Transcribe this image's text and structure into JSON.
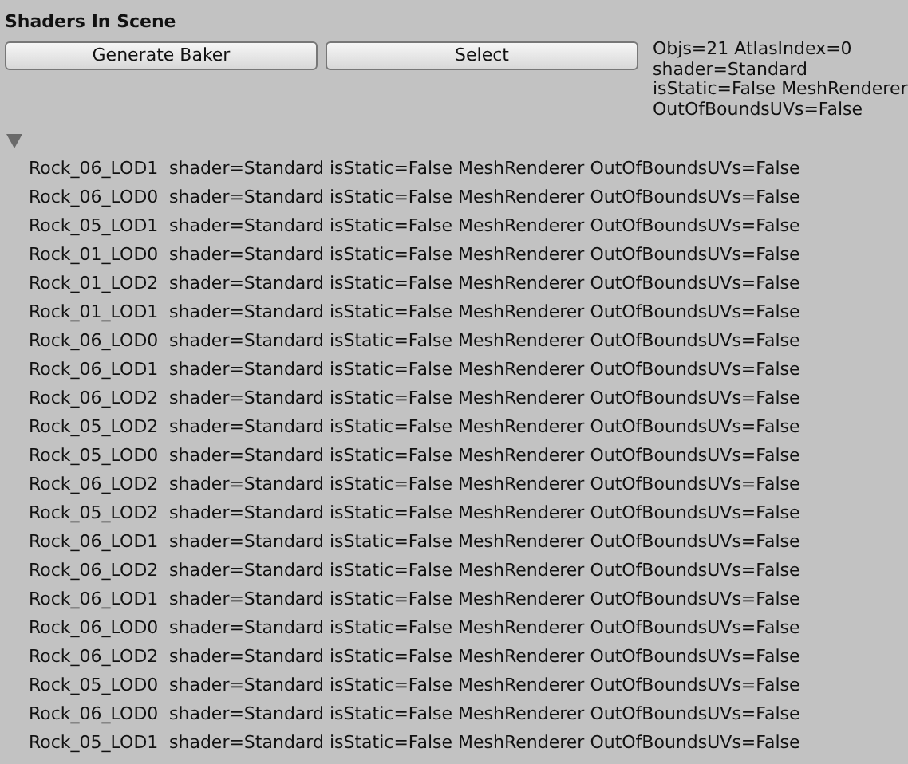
{
  "title": "Shaders In Scene",
  "buttons": [
    {
      "label": "Generate Baker"
    },
    {
      "label": "Select"
    }
  ],
  "info_lines": [
    "Objs=21 AtlasIndex=0",
    "shader=Standard",
    "isStatic=False MeshRenderer",
    "OutOfBoundsUVs=False"
  ],
  "foldout": {
    "expanded": true
  },
  "rows": [
    {
      "name": "Rock_06_LOD1",
      "details": "shader=Standard isStatic=False MeshRenderer OutOfBoundsUVs=False"
    },
    {
      "name": "Rock_06_LOD0",
      "details": "shader=Standard isStatic=False MeshRenderer OutOfBoundsUVs=False"
    },
    {
      "name": "Rock_05_LOD1",
      "details": "shader=Standard isStatic=False MeshRenderer OutOfBoundsUVs=False"
    },
    {
      "name": "Rock_01_LOD0",
      "details": "shader=Standard isStatic=False MeshRenderer OutOfBoundsUVs=False"
    },
    {
      "name": "Rock_01_LOD2",
      "details": "shader=Standard isStatic=False MeshRenderer OutOfBoundsUVs=False"
    },
    {
      "name": "Rock_01_LOD1",
      "details": "shader=Standard isStatic=False MeshRenderer OutOfBoundsUVs=False"
    },
    {
      "name": "Rock_06_LOD0",
      "details": "shader=Standard isStatic=False MeshRenderer OutOfBoundsUVs=False"
    },
    {
      "name": "Rock_06_LOD1",
      "details": "shader=Standard isStatic=False MeshRenderer OutOfBoundsUVs=False"
    },
    {
      "name": "Rock_06_LOD2",
      "details": "shader=Standard isStatic=False MeshRenderer OutOfBoundsUVs=False"
    },
    {
      "name": "Rock_05_LOD2",
      "details": "shader=Standard isStatic=False MeshRenderer OutOfBoundsUVs=False"
    },
    {
      "name": "Rock_05_LOD0",
      "details": "shader=Standard isStatic=False MeshRenderer OutOfBoundsUVs=False"
    },
    {
      "name": "Rock_06_LOD2",
      "details": "shader=Standard isStatic=False MeshRenderer OutOfBoundsUVs=False"
    },
    {
      "name": "Rock_05_LOD2",
      "details": "shader=Standard isStatic=False MeshRenderer OutOfBoundsUVs=False"
    },
    {
      "name": "Rock_06_LOD1",
      "details": "shader=Standard isStatic=False MeshRenderer OutOfBoundsUVs=False"
    },
    {
      "name": "Rock_06_LOD2",
      "details": "shader=Standard isStatic=False MeshRenderer OutOfBoundsUVs=False"
    },
    {
      "name": "Rock_06_LOD1",
      "details": "shader=Standard isStatic=False MeshRenderer OutOfBoundsUVs=False"
    },
    {
      "name": "Rock_06_LOD0",
      "details": "shader=Standard isStatic=False MeshRenderer OutOfBoundsUVs=False"
    },
    {
      "name": "Rock_06_LOD2",
      "details": "shader=Standard isStatic=False MeshRenderer OutOfBoundsUVs=False"
    },
    {
      "name": "Rock_05_LOD0",
      "details": "shader=Standard isStatic=False MeshRenderer OutOfBoundsUVs=False"
    },
    {
      "name": "Rock_06_LOD0",
      "details": "shader=Standard isStatic=False MeshRenderer OutOfBoundsUVs=False"
    },
    {
      "name": "Rock_05_LOD1",
      "details": "shader=Standard isStatic=False MeshRenderer OutOfBoundsUVs=False"
    }
  ]
}
